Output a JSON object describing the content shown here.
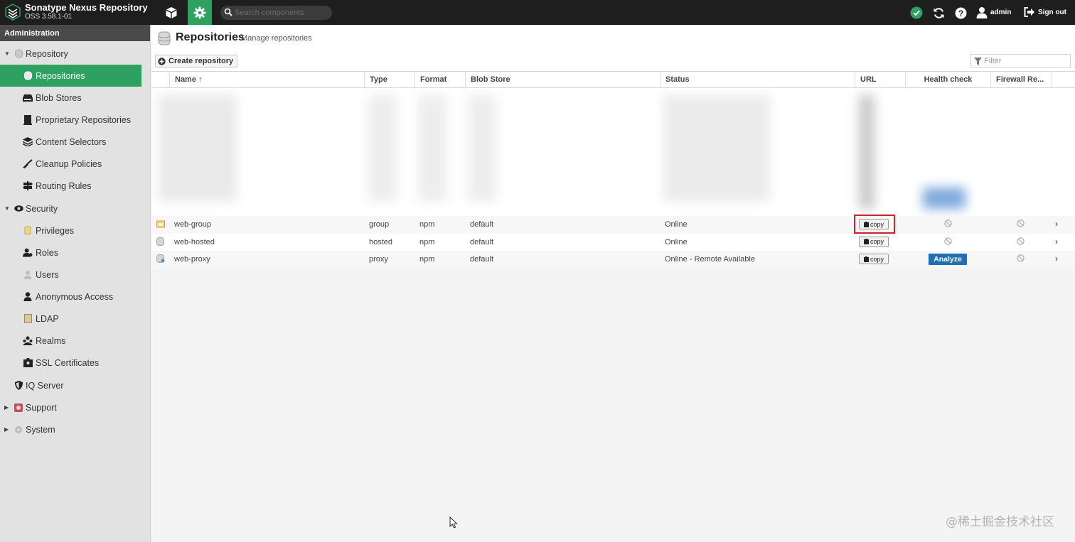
{
  "app": {
    "name": "Sonatype Nexus Repository",
    "version": "OSS 3.58.1-01"
  },
  "topbar": {
    "search_placeholder": "Search components",
    "user": "admin",
    "signout": "Sign out"
  },
  "sidebar": {
    "header": "Administration",
    "items": [
      {
        "label": "Repository",
        "icon": "database-icon"
      },
      {
        "label": "Repositories",
        "icon": "database-icon"
      },
      {
        "label": "Blob Stores",
        "icon": "hdd-icon"
      },
      {
        "label": "Proprietary Repositories",
        "icon": "book-icon"
      },
      {
        "label": "Content Selectors",
        "icon": "layers-icon"
      },
      {
        "label": "Cleanup Policies",
        "icon": "broom-icon"
      },
      {
        "label": "Routing Rules",
        "icon": "signpost-icon"
      },
      {
        "label": "Security",
        "icon": "eye-icon"
      },
      {
        "label": "Privileges",
        "icon": "privilege-icon"
      },
      {
        "label": "Roles",
        "icon": "roles-icon"
      },
      {
        "label": "Users",
        "icon": "users-icon"
      },
      {
        "label": "Anonymous Access",
        "icon": "user-icon"
      },
      {
        "label": "LDAP",
        "icon": "ldap-book-icon"
      },
      {
        "label": "Realms",
        "icon": "realms-icon"
      },
      {
        "label": "SSL Certificates",
        "icon": "certificate-icon"
      },
      {
        "label": "IQ Server",
        "icon": "shield-icon"
      },
      {
        "label": "Support",
        "icon": "support-icon"
      },
      {
        "label": "System",
        "icon": "gear-icon"
      }
    ]
  },
  "page": {
    "title": "Repositories",
    "subtitle": "Manage repositories",
    "create_button": "Create repository",
    "filter_placeholder": "Filter"
  },
  "columns": [
    "Name ↑",
    "Type",
    "Format",
    "Blob Store",
    "Status",
    "URL",
    "Health check",
    "Firewall Re..."
  ],
  "rows": [
    {
      "name": "web-group",
      "type": "group",
      "format": "npm",
      "blob": "default",
      "status": "Online",
      "url_button": "copy",
      "health": "none",
      "firewall": "none"
    },
    {
      "name": "web-hosted",
      "type": "hosted",
      "format": "npm",
      "blob": "default",
      "status": "Online",
      "url_button": "copy",
      "health": "none",
      "firewall": "none"
    },
    {
      "name": "web-proxy",
      "type": "proxy",
      "format": "npm",
      "blob": "default",
      "status": "Online - Remote Available",
      "url_button": "copy",
      "health": "Analyze",
      "firewall": "none"
    }
  ],
  "watermark": "@稀土掘金技术社区",
  "colors": {
    "accent": "#2ea060",
    "topbar": "#1e1e1e",
    "analyze": "#1f6fb8",
    "highlight": "#d0202a"
  }
}
